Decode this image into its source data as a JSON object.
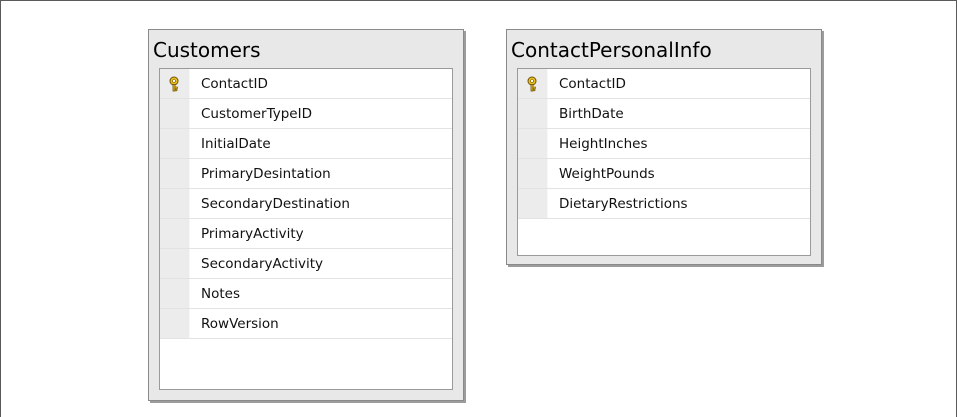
{
  "tables": [
    {
      "title": "Customers",
      "columns": [
        {
          "name": "ContactID",
          "primary_key": true
        },
        {
          "name": "CustomerTypeID",
          "primary_key": false
        },
        {
          "name": "InitialDate",
          "primary_key": false
        },
        {
          "name": "PrimaryDesintation",
          "primary_key": false
        },
        {
          "name": "SecondaryDestination",
          "primary_key": false
        },
        {
          "name": "PrimaryActivity",
          "primary_key": false
        },
        {
          "name": "SecondaryActivity",
          "primary_key": false
        },
        {
          "name": "Notes",
          "primary_key": false
        },
        {
          "name": "RowVersion",
          "primary_key": false
        }
      ]
    },
    {
      "title": "ContactPersonalInfo",
      "columns": [
        {
          "name": "ContactID",
          "primary_key": true
        },
        {
          "name": "BirthDate",
          "primary_key": false
        },
        {
          "name": "HeightInches",
          "primary_key": false
        },
        {
          "name": "WeightPounds",
          "primary_key": false
        },
        {
          "name": "DietaryRestrictions",
          "primary_key": false
        }
      ]
    }
  ],
  "colors": {
    "key_icon": "#f0c020",
    "table_frame": "#e8e8e8"
  },
  "icons": {
    "primary_key": "key-icon"
  }
}
